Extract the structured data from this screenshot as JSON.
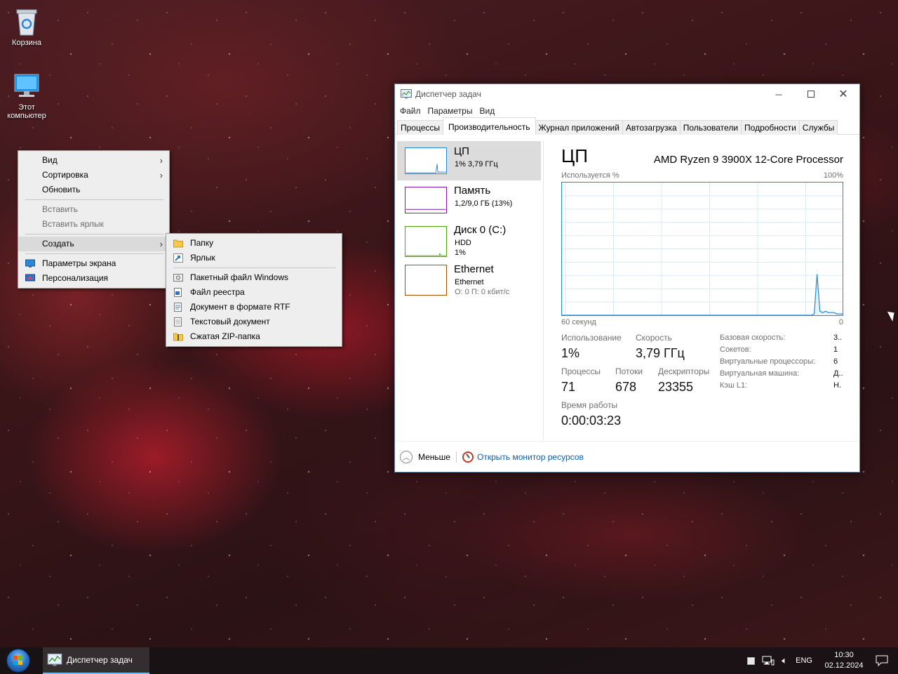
{
  "desktop": {
    "icons": [
      {
        "label": "Корзина"
      },
      {
        "label": "Этот компьютер"
      }
    ]
  },
  "context_menu": {
    "items": [
      {
        "label": "Вид",
        "submenu": true
      },
      {
        "label": "Сортировка",
        "submenu": true
      },
      {
        "label": "Обновить"
      },
      {
        "label": "Вставить",
        "disabled": true
      },
      {
        "label": "Вставить ярлык",
        "disabled": true
      },
      {
        "label": "Создать",
        "submenu": true,
        "highlighted": true
      },
      {
        "label": "Параметры экрана",
        "icon": "display-settings-icon"
      },
      {
        "label": "Персонализация",
        "icon": "personalization-icon"
      }
    ]
  },
  "create_submenu": {
    "items": [
      {
        "label": "Папку",
        "icon": "folder-icon"
      },
      {
        "label": "Ярлык",
        "icon": "shortcut-icon"
      },
      {
        "label": "Пакетный файл Windows",
        "icon": "batch-file-icon"
      },
      {
        "label": "Файл реестра",
        "icon": "registry-file-icon"
      },
      {
        "label": "Документ в формате RTF",
        "icon": "rtf-document-icon"
      },
      {
        "label": "Текстовый документ",
        "icon": "text-document-icon"
      },
      {
        "label": "Сжатая ZIP-папка",
        "icon": "zip-folder-icon"
      }
    ]
  },
  "task_manager": {
    "title": "Диспетчер задач",
    "menu": [
      "Файл",
      "Параметры",
      "Вид"
    ],
    "tabs": [
      "Процессы",
      "Производительность",
      "Журнал приложений",
      "Автозагрузка",
      "Пользователи",
      "Подробности",
      "Службы"
    ],
    "active_tab": "Производительность",
    "resources": [
      {
        "name": "ЦП",
        "sub1": "1% 3,79 ГГц",
        "sub2": "",
        "color": "#1f8bd3"
      },
      {
        "name": "Память",
        "sub1": "1,2/9,0 ГБ (13%)",
        "sub2": "",
        "color": "#8b12ae"
      },
      {
        "name": "Диск 0 (C:)",
        "sub1": "HDD",
        "sub2": "1%",
        "color": "#4da60c"
      },
      {
        "name": "Ethernet",
        "sub1": "Ethernet",
        "sub2": "О: 0 П: 0 кбит/с",
        "color": "#a74f01"
      }
    ],
    "panel": {
      "title": "ЦП",
      "processor": "AMD Ryzen 9 3900X 12-Core Processor",
      "y_label": "Используется %",
      "y_max_label": "100%",
      "x_left_label": "60 секунд",
      "x_right_label": "0",
      "usage_label": "Использование",
      "usage_value": "1%",
      "speed_label": "Скорость",
      "speed_value": "3,79 ГГц",
      "processes_label": "Процессы",
      "processes_value": "71",
      "threads_label": "Потоки",
      "threads_value": "678",
      "handles_label": "Дескрипторы",
      "handles_value": "23355",
      "uptime_label": "Время работы",
      "uptime_value": "0:00:03:23",
      "info": [
        {
          "label": "Базовая скорость:",
          "value": "3.."
        },
        {
          "label": "Сокетов:",
          "value": "1"
        },
        {
          "label": "Виртуальные процессоры:",
          "value": "6"
        },
        {
          "label": "Виртуальная машина:",
          "value": "Д.."
        },
        {
          "label": "Кэш L1:",
          "value": "Н."
        }
      ]
    },
    "footer": {
      "less_label": "Меньше",
      "monitor_link": "Открыть монитор ресурсов"
    },
    "cpu_history": [
      0,
      0,
      0,
      0,
      0,
      0,
      0,
      0,
      0,
      0,
      0,
      0,
      0,
      0,
      0,
      0,
      0,
      0,
      0,
      0,
      0,
      0,
      0,
      0,
      0,
      0,
      0,
      0,
      0,
      0,
      0,
      0,
      0,
      0,
      0,
      0,
      0,
      0,
      0,
      0,
      0,
      0,
      0,
      0,
      0,
      0,
      0,
      0,
      0,
      0,
      0,
      0,
      0,
      0,
      0,
      0,
      0,
      0,
      0,
      0,
      0,
      0,
      0,
      0,
      0,
      0,
      0,
      0,
      0,
      0,
      0,
      0,
      0,
      0,
      0,
      0,
      0,
      0,
      0,
      0,
      0,
      0,
      0,
      0,
      0,
      0,
      0,
      0,
      0,
      1,
      31,
      3,
      2,
      3,
      2,
      2,
      2,
      1,
      1,
      1
    ]
  },
  "taskbar": {
    "app_label": "Диспетчер задач",
    "lang": "ENG",
    "time": "10:30",
    "date": "02.12.2024"
  }
}
